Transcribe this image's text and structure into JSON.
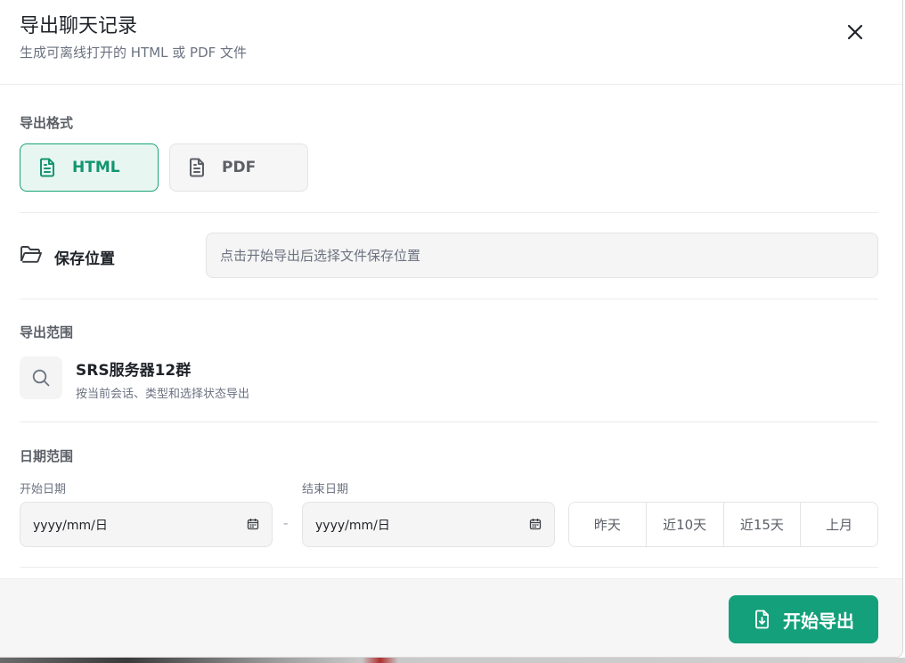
{
  "dialog": {
    "title": "导出聊天记录",
    "subtitle": "生成可离线打开的 HTML 或 PDF 文件"
  },
  "format": {
    "label": "导出格式",
    "options": [
      {
        "label": "HTML",
        "selected": true
      },
      {
        "label": "PDF",
        "selected": false
      }
    ]
  },
  "save": {
    "label": "保存位置",
    "placeholder": "点击开始导出后选择文件保存位置"
  },
  "scope": {
    "label": "导出范围",
    "name": "SRS服务器12群",
    "description": "按当前会话、类型和选择状态导出"
  },
  "date_range": {
    "label": "日期范围",
    "start_label": "开始日期",
    "end_label": "结束日期",
    "start_value": "yyyy/mm/日",
    "end_value": "yyyy/mm/日",
    "separator": "-",
    "quick": [
      "昨天",
      "近10天",
      "近15天",
      "上月"
    ]
  },
  "footer": {
    "export_label": "开始导出"
  },
  "colors": {
    "accent": "#14a07a",
    "accent_light": "#e8f6f1"
  }
}
